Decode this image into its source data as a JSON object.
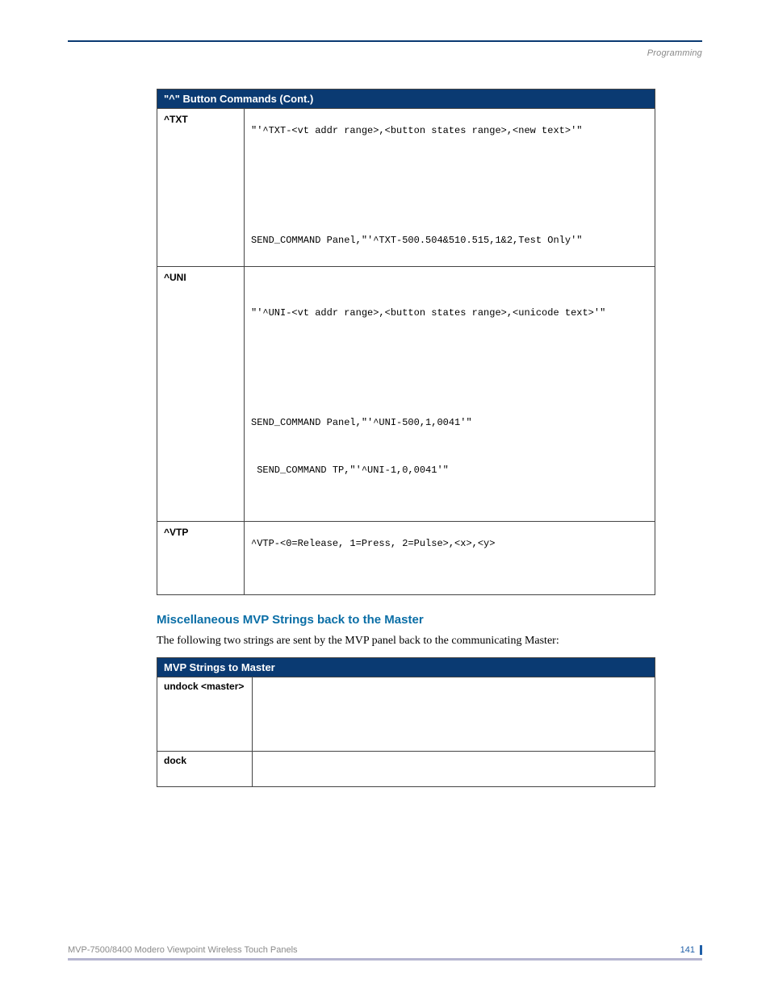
{
  "header": {
    "section": "Programming"
  },
  "table1": {
    "title": "\"^\" Button Commands (Cont.)",
    "rows": [
      {
        "name": "^TXT",
        "code1": "\"'^TXT-<vt addr range>,<button states range>,<new text>'\"",
        "code2": "SEND_COMMAND Panel,\"'^TXT-500.504&510.515,1&2,Test Only'\""
      },
      {
        "name": "^UNI",
        "code1": "\"'^UNI-<vt addr range>,<button states range>,<unicode text>'\"",
        "code2": "SEND_COMMAND Panel,\"'^UNI-500,1,0041'\"",
        "code3": " SEND_COMMAND TP,\"'^UNI-1,0,0041'\""
      },
      {
        "name": "^VTP",
        "code1": "^VTP-<0=Release, 1=Press, 2=Pulse>,<x>,<y>"
      }
    ]
  },
  "section": {
    "title": "Miscellaneous MVP Strings back to the Master",
    "text": "The following two strings are sent by the MVP panel back to the communicating Master:"
  },
  "table2": {
    "title": "MVP Strings to Master",
    "rows": [
      {
        "name": "undock <master>"
      },
      {
        "name": "dock"
      }
    ]
  },
  "footer": {
    "product": "MVP-7500/8400 Modero Viewpoint Wireless Touch Panels",
    "page": "141"
  }
}
